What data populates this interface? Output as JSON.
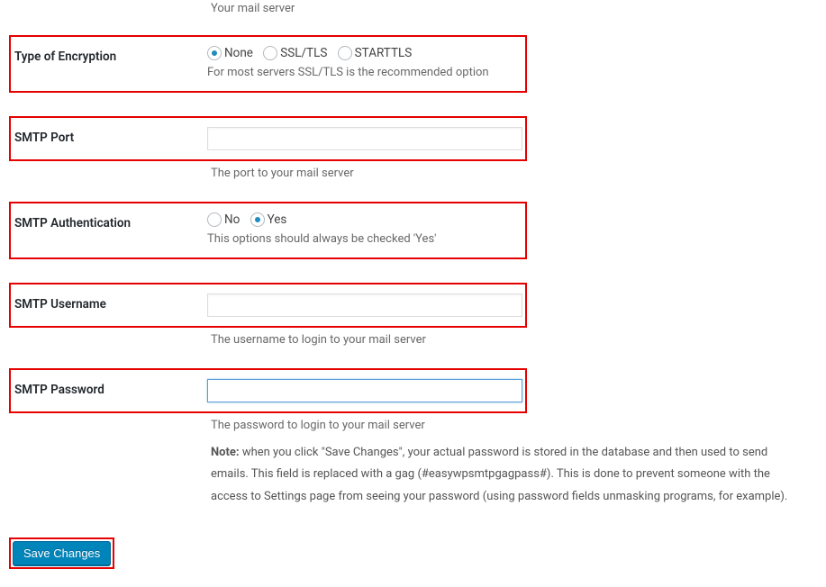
{
  "mailserver_desc": "Your mail server",
  "encryption": {
    "label": "Type of Encryption",
    "options": {
      "none": "None",
      "ssl": "SSL/TLS",
      "starttls": "STARTTLS"
    },
    "selected": "none",
    "desc": "For most servers SSL/TLS is the recommended option"
  },
  "port": {
    "label": "SMTP Port",
    "value": "",
    "desc": "The port to your mail server"
  },
  "auth": {
    "label": "SMTP Authentication",
    "options": {
      "no": "No",
      "yes": "Yes"
    },
    "selected": "yes",
    "desc": "This options should always be checked 'Yes'"
  },
  "username": {
    "label": "SMTP Username",
    "value": "",
    "desc": "The username to login to your mail server"
  },
  "password": {
    "label": "SMTP Password",
    "value": "",
    "desc": "The password to login to your mail server",
    "note_label": "Note:",
    "note_text": " when you click \"Save Changes\", your actual password is stored in the database and then used to send emails. This field is replaced with a gag (#easywpsmtpgagpass#). This is done to prevent someone with the access to Settings page from seeing your password (using password fields unmasking programs, for example)."
  },
  "submit": {
    "label": "Save Changes"
  }
}
